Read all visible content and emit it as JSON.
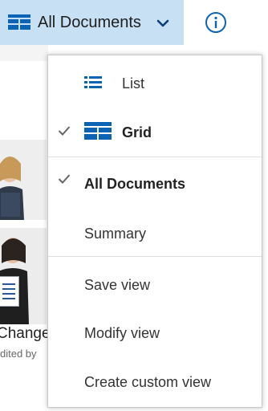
{
  "topbar": {
    "view_label": "All Documents",
    "view_icon": "grid-icon",
    "chevron_icon": "chevron-down-icon",
    "info_icon": "info-icon",
    "accent_color": "#0b63b6",
    "selected_bg": "#c7e0f4"
  },
  "background": {
    "doc_title": "Change",
    "doc_subtitle": "dited by"
  },
  "menu": {
    "layout_items": [
      {
        "label": "List",
        "icon": "list-icon",
        "checked": false,
        "bold": false
      },
      {
        "label": "Grid",
        "icon": "grid-icon",
        "checked": true,
        "bold": true
      }
    ],
    "view_items": [
      {
        "label": "All Documents",
        "checked": true,
        "bold": true
      },
      {
        "label": "Summary",
        "checked": false,
        "bold": false
      }
    ],
    "action_items": [
      {
        "label": "Save view"
      },
      {
        "label": "Modify view"
      },
      {
        "label": "Create custom view"
      }
    ]
  }
}
